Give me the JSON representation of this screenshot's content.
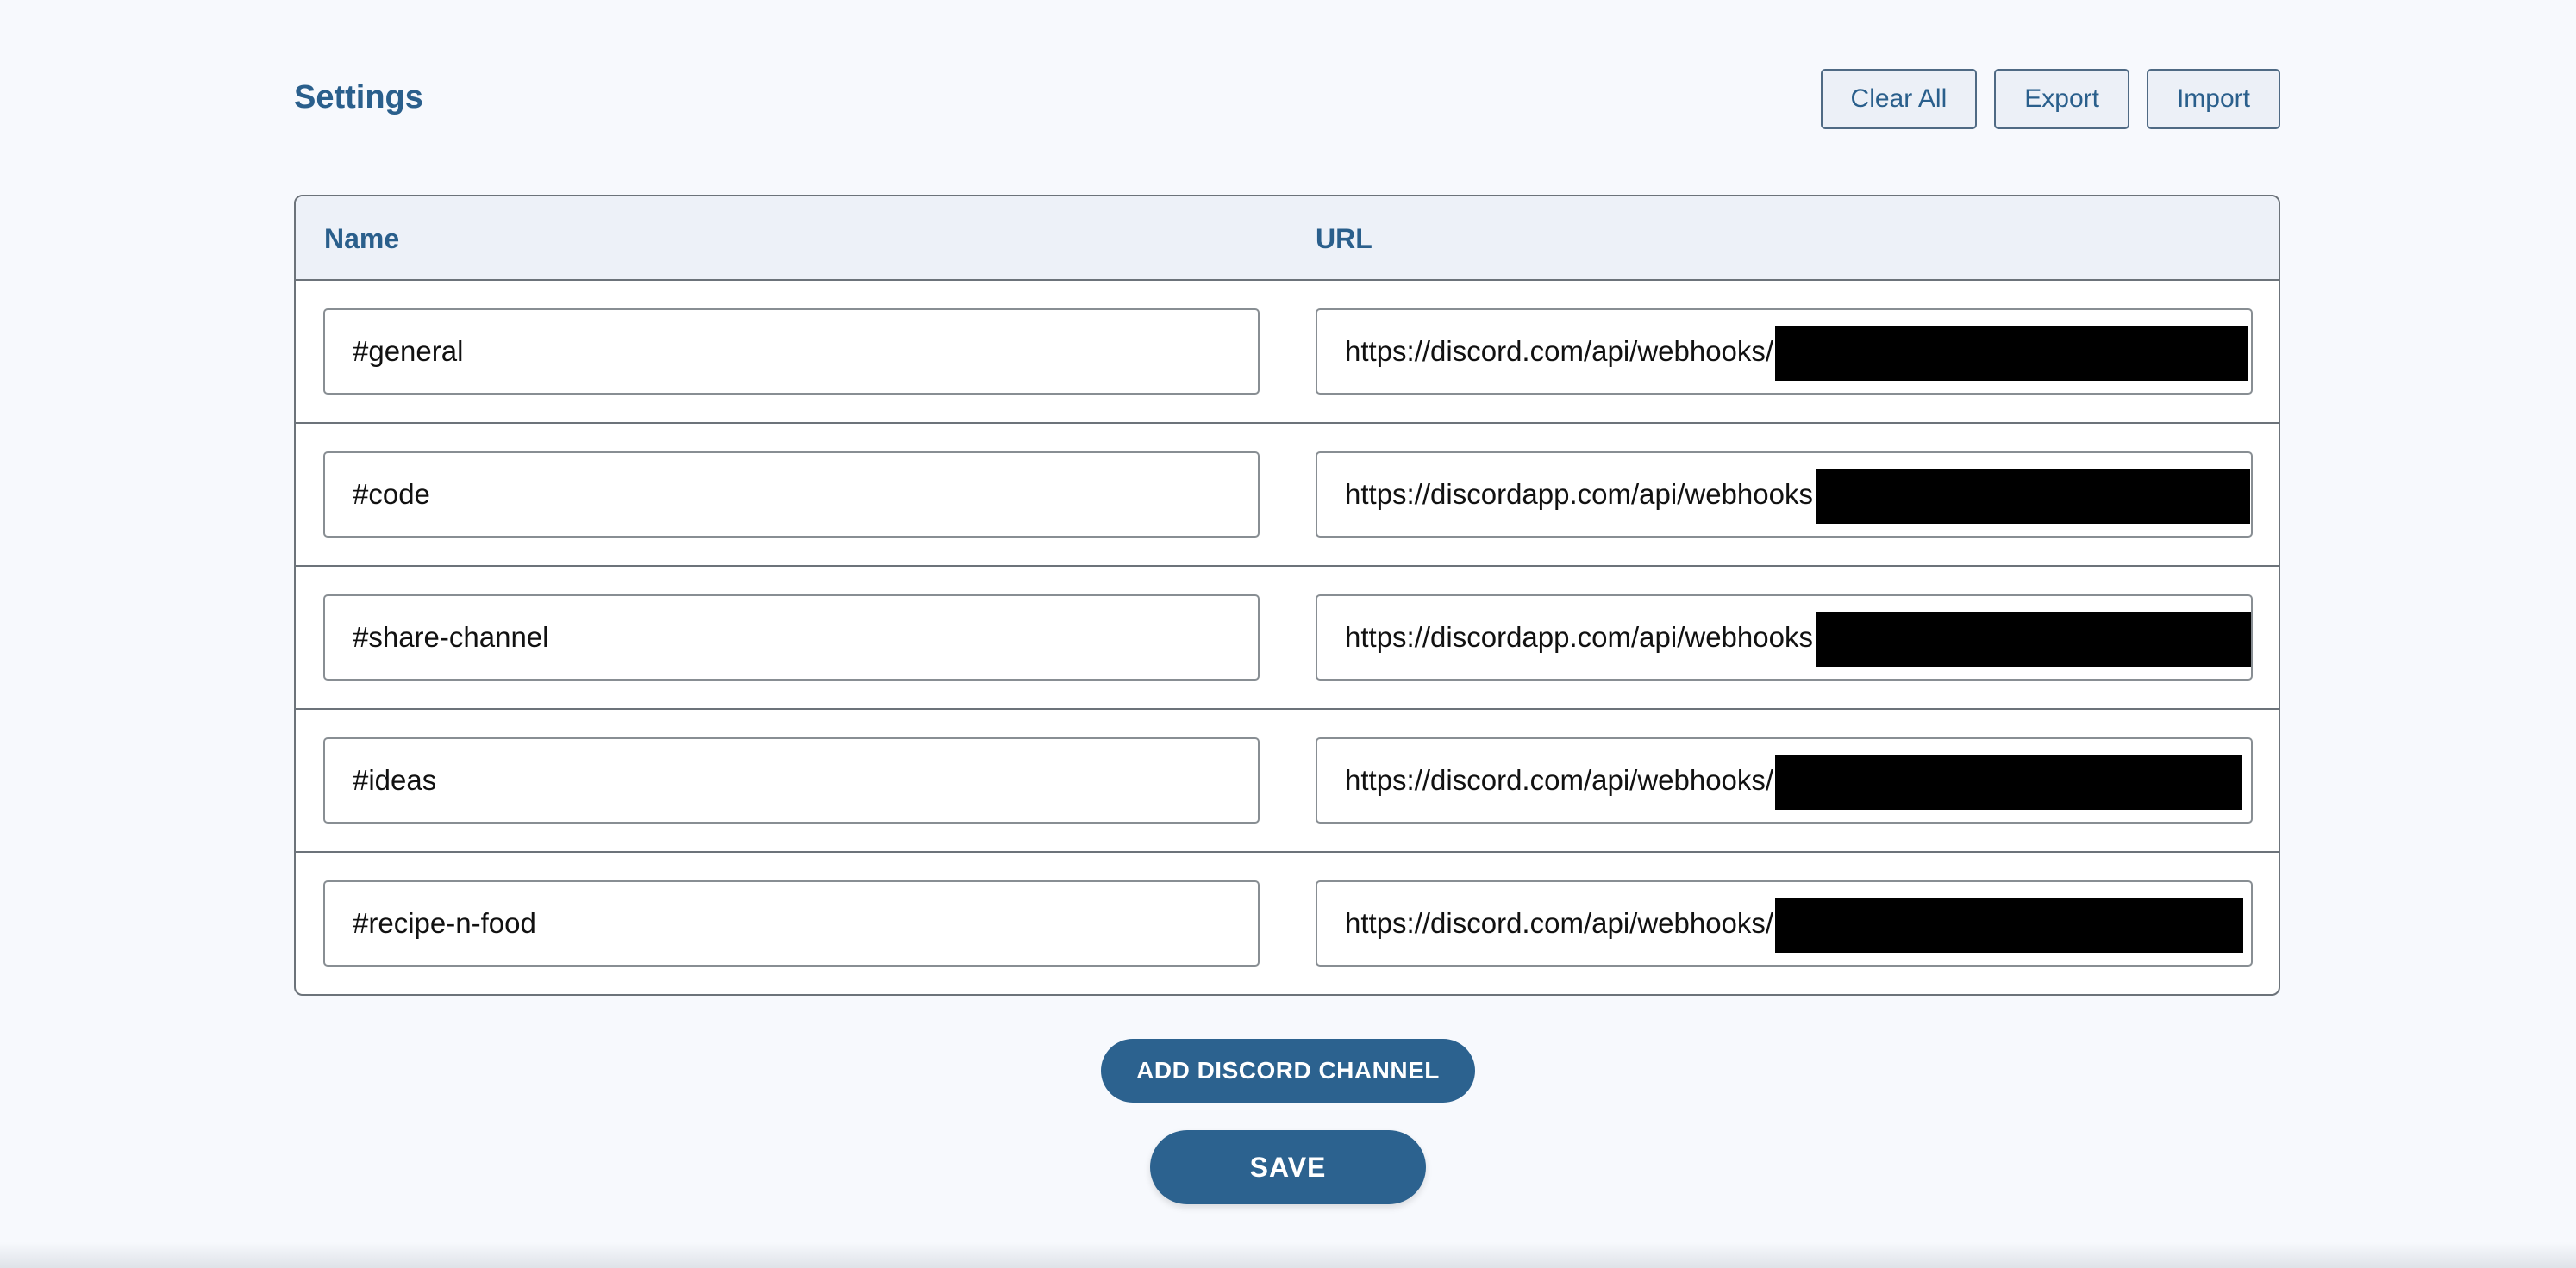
{
  "header": {
    "title": "Settings",
    "actions": {
      "clear_all": "Clear All",
      "export": "Export",
      "import": "Import"
    }
  },
  "table": {
    "columns": {
      "name": "Name",
      "url": "URL"
    },
    "rows": [
      {
        "name": "#general",
        "url": "https://discord.com/api/webhooks/"
      },
      {
        "name": "#code",
        "url": "https://discordapp.com/api/webhooks"
      },
      {
        "name": "#share-channel",
        "url": "https://discordapp.com/api/webhooks"
      },
      {
        "name": "#ideas",
        "url": "https://discord.com/api/webhooks/"
      },
      {
        "name": "#recipe-n-food",
        "url": "https://discord.com/api/webhooks/"
      }
    ]
  },
  "buttons": {
    "add_channel": "ADD DISCORD CHANNEL",
    "save": "SAVE"
  },
  "colors": {
    "accent": "#2c628f",
    "title": "#2a5f8c",
    "background": "#f7f9fd",
    "table_header_bg": "#edf1f8"
  }
}
